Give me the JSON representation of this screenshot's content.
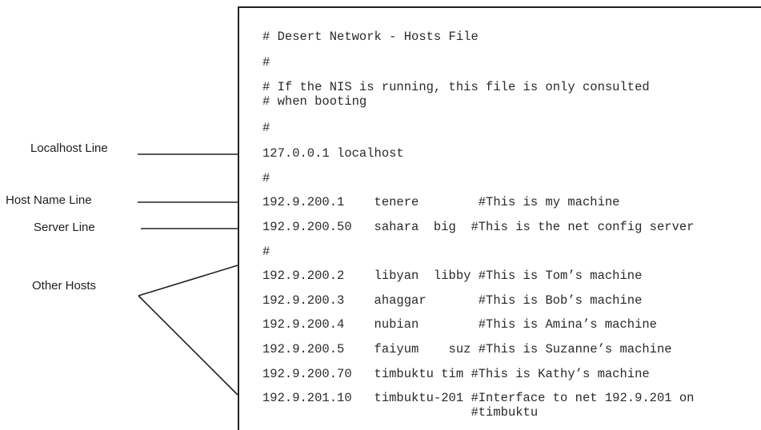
{
  "hosts_file": {
    "lines": [
      "# Desert Network - Hosts File",
      "#",
      "# If the NIS is running, this file is only consulted",
      "# when booting",
      "#",
      "127.0.0.1 localhost",
      "#",
      "192.9.200.1    tenere        #This is my machine",
      "192.9.200.50   sahara  big  #This is the net config server",
      "#",
      "192.9.200.2    libyan  libby #This is Tom’s machine",
      "192.9.200.3    ahaggar       #This is Bob’s machine",
      "192.9.200.4    nubian        #This is Amina’s machine",
      "192.9.200.5    faiyum    suz #This is Suzanne’s machine",
      "192.9.200.70   timbuktu tim #This is Kathy’s machine",
      "192.9.201.10   timbuktu-201 #Interface to net 192.9.201 on",
      "                            #timbuktu"
    ]
  },
  "callouts": {
    "localhost": "Localhost Line",
    "host_name": "Host Name Line",
    "server": "Server Line",
    "other_hosts": "Other Hosts"
  },
  "colors": {
    "text": "#2a2a2a",
    "lines": "#222222",
    "background": "#ffffff"
  }
}
